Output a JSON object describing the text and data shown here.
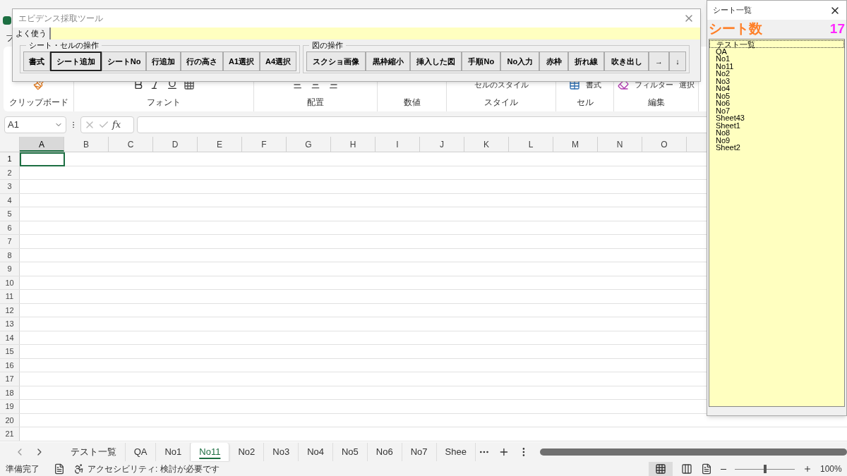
{
  "excel": {
    "ribbon_tab_fragment": "フ",
    "ribbon_groups": [
      {
        "label": "クリップボード"
      },
      {
        "label": "フォント"
      },
      {
        "label": "配置"
      },
      {
        "label": "数値"
      },
      {
        "label": "スタイル",
        "commands": [
          "セルのスタイル"
        ]
      },
      {
        "label": "セル",
        "commands": [
          "書式"
        ]
      },
      {
        "label": "編集",
        "commands": [
          "フィルター",
          "選択"
        ]
      }
    ],
    "name_box": "A1",
    "formula_symbol": "fx",
    "columns": [
      "A",
      "B",
      "C",
      "D",
      "E",
      "F",
      "G",
      "H",
      "I",
      "J",
      "K",
      "L",
      "M",
      "N",
      "O"
    ],
    "rows": [
      "1",
      "2",
      "3",
      "4",
      "5",
      "6",
      "7",
      "8",
      "9",
      "10",
      "11",
      "12",
      "13",
      "14",
      "15",
      "16",
      "17",
      "18",
      "19",
      "20",
      "21"
    ],
    "sheet_tabs": [
      {
        "label": "テスト一覧",
        "selected": false
      },
      {
        "label": "QA",
        "selected": false
      },
      {
        "label": "No1",
        "selected": false
      },
      {
        "label": "No11",
        "selected": true
      },
      {
        "label": "No2",
        "selected": false
      },
      {
        "label": "No3",
        "selected": false
      },
      {
        "label": "No4",
        "selected": false
      },
      {
        "label": "No5",
        "selected": false
      },
      {
        "label": "No6",
        "selected": false
      },
      {
        "label": "No7",
        "selected": false
      },
      {
        "label": "Shee",
        "selected": false
      }
    ],
    "status": [
      "準備完了",
      "アクセシビリティ: 検討が必要です"
    ],
    "zoom": {
      "level": 0.5,
      "reading": "100%"
    }
  },
  "evidence_tool": {
    "title": "エビデンス採取ツール",
    "tabs": [
      {
        "label": "よく使う",
        "selected": true
      }
    ],
    "groups": [
      {
        "title": "シート・セルの操作",
        "buttons": [
          {
            "label": "書式",
            "focused": false
          },
          {
            "label": "シート追加",
            "focused": true
          },
          {
            "label": "シートNo",
            "focused": false
          },
          {
            "label": "行追加",
            "focused": false
          },
          {
            "label": "行の高さ",
            "focused": false
          },
          {
            "label": "A1選択",
            "focused": false
          },
          {
            "label": "A4選択",
            "focused": false
          }
        ]
      },
      {
        "title": "図の操作",
        "buttons": [
          {
            "label": "スクショ画像",
            "focused": false
          },
          {
            "label": "黒枠縮小",
            "focused": false
          },
          {
            "label": "挿入した図",
            "focused": false
          },
          {
            "label": "手順No",
            "focused": false
          },
          {
            "label": "No入力",
            "focused": false
          },
          {
            "label": "赤枠",
            "focused": false
          },
          {
            "label": "折れ線",
            "focused": false
          },
          {
            "label": "吹き出し",
            "focused": false
          },
          {
            "label": "→",
            "focused": false
          },
          {
            "label": "↓",
            "focused": false
          }
        ]
      }
    ]
  },
  "sheet_list": {
    "title": "シート一覧",
    "count_label": "シート数",
    "count": "17",
    "items": [
      {
        "name": "テスト一覧",
        "selected": true
      },
      {
        "name": "QA",
        "selected": false
      },
      {
        "name": "No1",
        "selected": false
      },
      {
        "name": "No11",
        "selected": false
      },
      {
        "name": "No2",
        "selected": false
      },
      {
        "name": "No3",
        "selected": false
      },
      {
        "name": "No4",
        "selected": false
      },
      {
        "name": "No5",
        "selected": false
      },
      {
        "name": "No6",
        "selected": false
      },
      {
        "name": "No7",
        "selected": false
      },
      {
        "name": "Sheet43",
        "selected": false
      },
      {
        "name": "Sheet1",
        "selected": false
      },
      {
        "name": "No8",
        "selected": false
      },
      {
        "name": "No9",
        "selected": false
      },
      {
        "name": "Sheet2",
        "selected": false
      }
    ]
  }
}
